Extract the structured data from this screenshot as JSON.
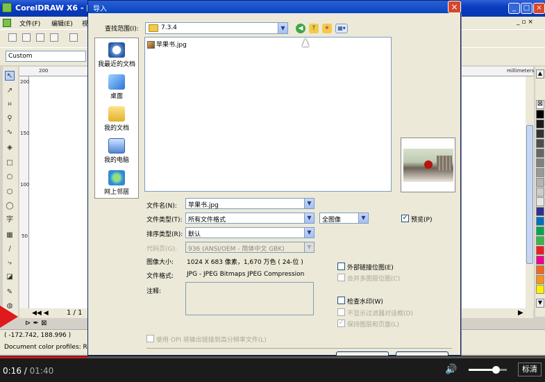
{
  "app": {
    "title": "CorelDRAW X6 - [",
    "menu": [
      "文件(F)",
      "编辑(E)",
      "视"
    ],
    "preset": "Custom",
    "ruler_top": [
      "200"
    ],
    "ruler_left": [
      "200",
      "150",
      "100",
      "50"
    ],
    "units": "millimeters",
    "page_nav": "1 / 1",
    "coords": "( -172.742, 188.996 )",
    "color_profile": "Document color profiles: RGB: s"
  },
  "dialog": {
    "title": "导入",
    "look_in_label": "查找范围(I):",
    "look_in_value": "7.3.4",
    "places": [
      "我最近的文档",
      "桌面",
      "我的文档",
      "我的电脑",
      "网上邻居"
    ],
    "files": [
      "苹果书.jpg"
    ],
    "filename_label": "文件名(N):",
    "filename_value": "苹果书.jpg",
    "filetype_label": "文件类型(T):",
    "filetype_value": "所有文件格式",
    "fullimage_value": "全图像",
    "sort_label": "排序类型(R):",
    "sort_value": "默认",
    "codepage_label": "代码页(G):",
    "codepage_value": "936  (ANSI/OEM - 简体中文 GBK)",
    "imagesize_label": "图像大小:",
    "imagesize_value": "1024 X 683 像素，1,670 万色 ( 24-位 )",
    "fileformat_label": "文件格式:",
    "fileformat_value": "JPG - JPEG Bitmaps JPEG Compression",
    "notes_label": "注释:",
    "preview_label": "预览(P)",
    "external_link_label": "外部链接位图(E)",
    "merge_layers_label": "合并多图层位图(C)",
    "check_watermark_label": "检查水印(W)",
    "no_filter_dialog_label": "不显示过滤器对话框(D)",
    "keep_layers_label": "保持图层和页面(L)",
    "opi_label": "使用 OPI 将输出链接到高分辨率文件(L)",
    "preview_checked": true
  },
  "player": {
    "current": "0:16",
    "total": "01:40",
    "progress": 0.16,
    "volume": 0.7,
    "cc_label": "标清"
  },
  "colors": {
    "titlebar": "#0a3cc0",
    "dialog_bg": "#ece9d8",
    "progress": "#cc181e"
  }
}
